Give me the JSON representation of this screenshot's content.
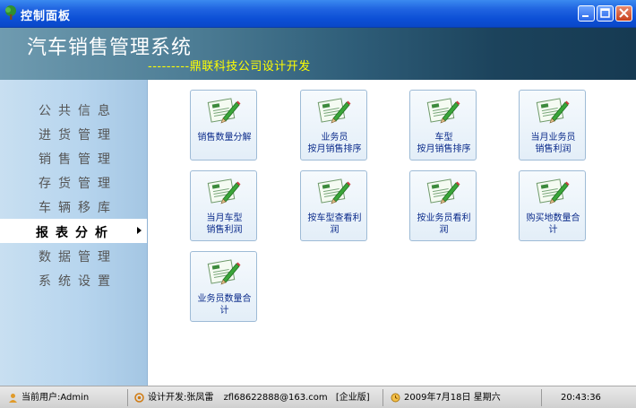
{
  "window": {
    "title": "控制面板"
  },
  "banner": {
    "title": "汽车销售管理系统",
    "subtitle": "---------鼎联科技公司设计开发"
  },
  "sidebar": {
    "items": [
      {
        "label": "公共信息",
        "active": false
      },
      {
        "label": "进货管理",
        "active": false
      },
      {
        "label": "销售管理",
        "active": false
      },
      {
        "label": "存货管理",
        "active": false
      },
      {
        "label": "车辆移库",
        "active": false
      },
      {
        "label": "报表分析",
        "active": true
      },
      {
        "label": "数据管理",
        "active": false
      },
      {
        "label": "系统设置",
        "active": false
      }
    ]
  },
  "tiles": [
    {
      "label": "销售数量分解",
      "icon": "report-edit-icon"
    },
    {
      "label": "业务员\n按月销售排序",
      "icon": "report-edit-icon"
    },
    {
      "label": "车型\n按月销售排序",
      "icon": "report-edit-icon"
    },
    {
      "label": "当月业务员\n销售利润",
      "icon": "report-edit-icon"
    },
    {
      "label": "当月车型\n销售利润",
      "icon": "report-edit-icon"
    },
    {
      "label": "按车型查看利\n润",
      "icon": "report-edit-icon"
    },
    {
      "label": "按业务员看利\n润",
      "icon": "report-edit-icon"
    },
    {
      "label": "购买地数量合\n计",
      "icon": "report-edit-icon"
    },
    {
      "label": "业务员数量合\n计",
      "icon": "report-edit-icon"
    }
  ],
  "statusbar": {
    "user": "当前用户:Admin",
    "developer": "设计开发:张凤雷",
    "contact": "zfl68622888@163.com",
    "edition": "[企业版]",
    "date": "2009年7月18日 星期六",
    "time": "20:43:36"
  },
  "colors": {
    "titlebar": "#0c4fd6",
    "banner_dark": "#163a52",
    "subtitle": "#ffff00",
    "sidebar": "#b7d5ee",
    "tile_text": "#0a2a8a"
  }
}
